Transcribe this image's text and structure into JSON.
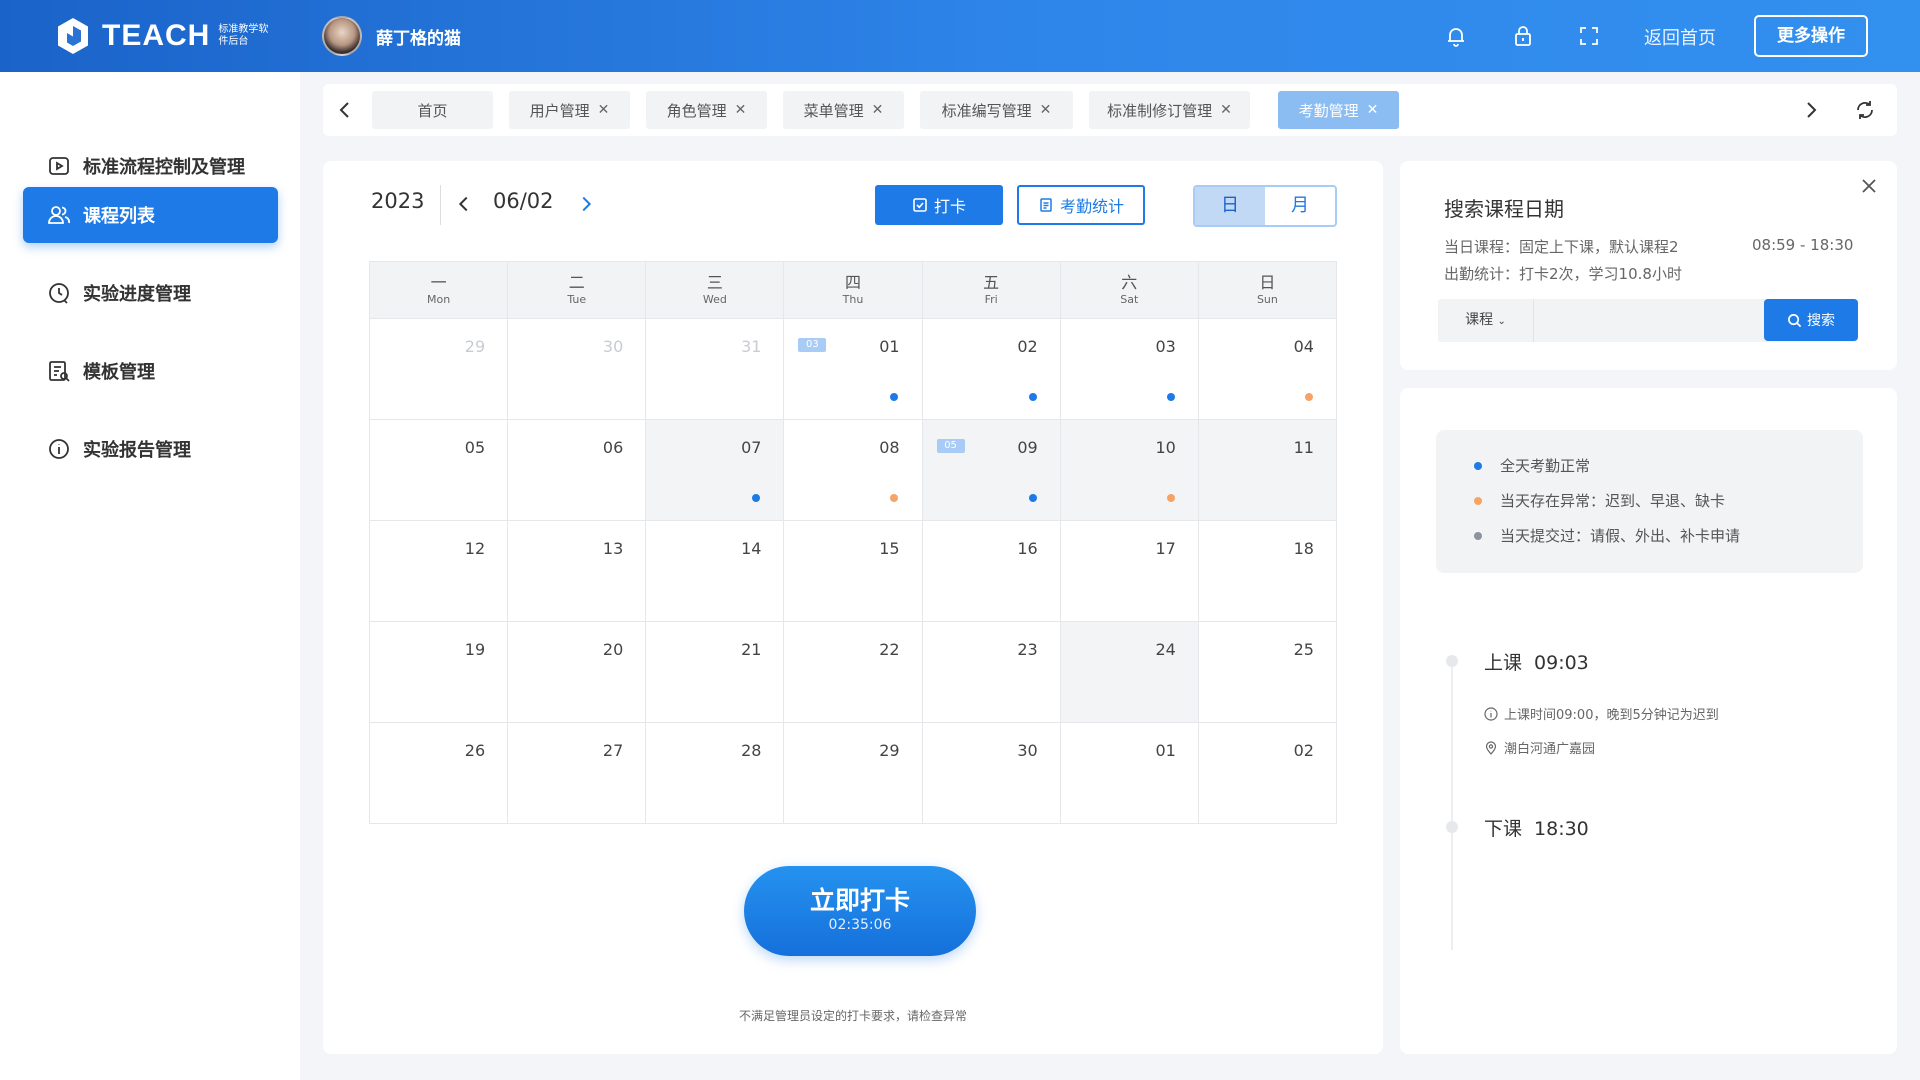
{
  "header": {
    "brand": "TEACH",
    "brand_sub": "标准教学软件后台",
    "user_name": "薛丁格的猫",
    "home_link": "返回首页",
    "more_button": "更多操作",
    "icons": [
      "bell-icon",
      "lock-icon",
      "fullscreen-icon"
    ]
  },
  "sidebar": {
    "items": [
      {
        "label": "标准流程控制及管理",
        "icon": "play-icon"
      },
      {
        "label": "课程列表",
        "icon": "users-icon"
      },
      {
        "label": "实验进度管理",
        "icon": "clock-icon"
      },
      {
        "label": "模板管理",
        "icon": "template-icon"
      },
      {
        "label": "实验报告管理",
        "icon": "info-icon"
      }
    ]
  },
  "tabs": {
    "items": [
      "首页",
      "用户管理",
      "角色管理",
      "菜单管理",
      "标准编写管理",
      "标准制修订管理",
      "考勤管理"
    ]
  },
  "calendar": {
    "year": "2023",
    "current_date": "06/02",
    "checkin_button": "打卡",
    "stats_button": "考勤统计",
    "view_day": "日",
    "view_month": "月",
    "weekday_cn": [
      "一",
      "二",
      "三",
      "四",
      "五",
      "六",
      "日"
    ],
    "weekday_en": [
      "Mon",
      "Tue",
      "Wed",
      "Thu",
      "Fri",
      "Sat",
      "Sun"
    ],
    "weeks": [
      [
        {
          "d": "29",
          "muted": true
        },
        {
          "d": "30",
          "muted": true
        },
        {
          "d": "31",
          "muted": true
        },
        {
          "d": "01",
          "tag": "03",
          "dot": "blue"
        },
        {
          "d": "02",
          "dot": "blue"
        },
        {
          "d": "03",
          "dot": "blue"
        },
        {
          "d": "04",
          "dot": "orange"
        }
      ],
      [
        {
          "d": "05"
        },
        {
          "d": "06"
        },
        {
          "d": "07",
          "gray": true,
          "dot": "blue"
        },
        {
          "d": "08",
          "dot": "orange"
        },
        {
          "d": "09",
          "gray": true,
          "tag": "05",
          "dot": "blue"
        },
        {
          "d": "10",
          "gray": true,
          "dot": "orange"
        },
        {
          "d": "11",
          "gray": true
        }
      ],
      [
        {
          "d": "12"
        },
        {
          "d": "13"
        },
        {
          "d": "14"
        },
        {
          "d": "15"
        },
        {
          "d": "16"
        },
        {
          "d": "17"
        },
        {
          "d": "18"
        }
      ],
      [
        {
          "d": "19"
        },
        {
          "d": "20"
        },
        {
          "d": "21"
        },
        {
          "d": "22"
        },
        {
          "d": "23"
        },
        {
          "d": "24",
          "gray": true
        },
        {
          "d": "25"
        }
      ],
      [
        {
          "d": "26"
        },
        {
          "d": "27"
        },
        {
          "d": "28"
        },
        {
          "d": "29"
        },
        {
          "d": "30"
        },
        {
          "d": "01"
        },
        {
          "d": "02"
        }
      ]
    ],
    "punch_label": "立即打卡",
    "punch_time": "02:35:06",
    "warning": "不满足管理员设定的打卡要求，请检查异常"
  },
  "search": {
    "title": "搜索课程日期",
    "today_course": "当日课程：固定上下课，默认课程2",
    "time_range": "08:59 - 18:30",
    "attendance": "出勤统计：打卡2次，学习10.8小时",
    "select_label": "课程",
    "button": "搜索"
  },
  "status": {
    "legend": [
      {
        "label": "全天考勤正常",
        "color": "#1e7ae6"
      },
      {
        "label": "当天存在异常：迟到、早退、缺卡",
        "color": "#f5a466"
      },
      {
        "label": "当天提交过：请假、外出、补卡申请",
        "color": "#8c939d"
      }
    ],
    "class_start_label": "上课",
    "class_start_time": "09:03",
    "class_start_rule": "上课时间09:00，晚到5分钟记为迟到",
    "location": "潮白河通广嘉园",
    "class_end_label": "下课",
    "class_end_time": "18:30"
  }
}
